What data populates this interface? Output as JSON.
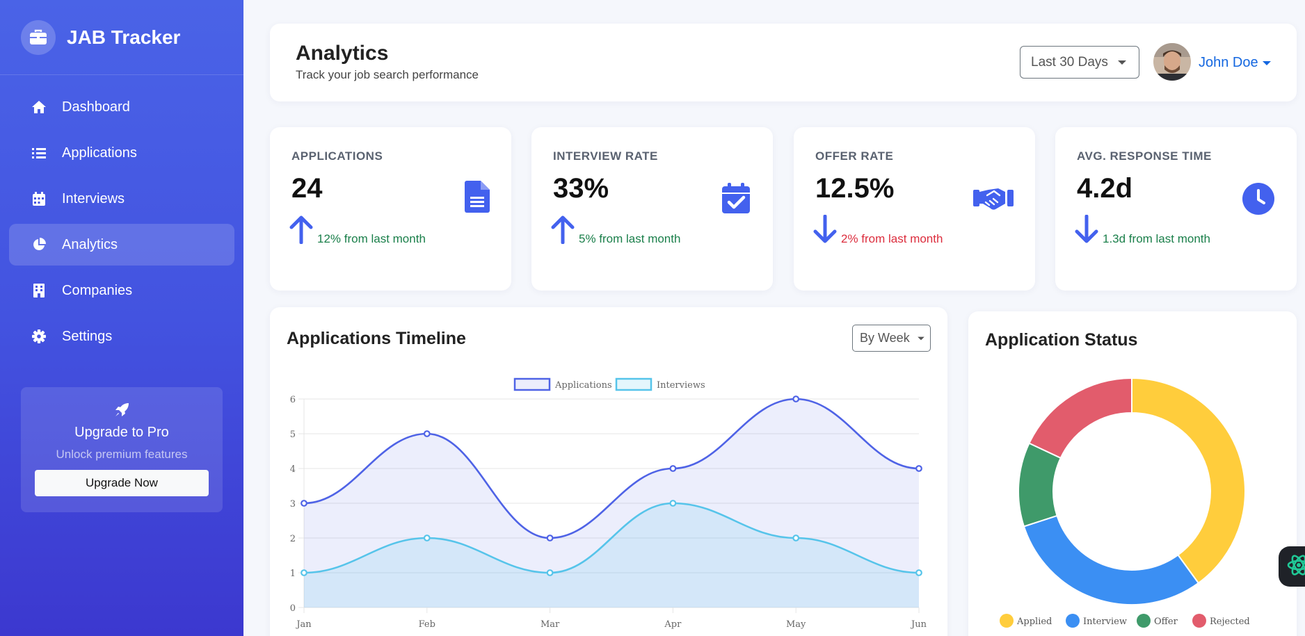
{
  "app": {
    "name": "JAB Tracker"
  },
  "sidebar": {
    "items": [
      {
        "label": "Dashboard",
        "icon": "home-icon",
        "active": false
      },
      {
        "label": "Applications",
        "icon": "list-icon",
        "active": false
      },
      {
        "label": "Interviews",
        "icon": "calendar-icon",
        "active": false
      },
      {
        "label": "Analytics",
        "icon": "pie-chart-icon",
        "active": true
      },
      {
        "label": "Companies",
        "icon": "building-icon",
        "active": false
      },
      {
        "label": "Settings",
        "icon": "gear-icon",
        "active": false
      }
    ],
    "promo": {
      "icon": "rocket-icon",
      "title": "Upgrade to Pro",
      "subtitle": "Unlock premium features",
      "button": "Upgrade Now"
    }
  },
  "header": {
    "title": "Analytics",
    "subtitle": "Track your job search performance",
    "range": "Last 30 Days",
    "user": "John Doe"
  },
  "stats": [
    {
      "label": "APPLICATIONS",
      "value": "24",
      "trend": "12% from last month",
      "direction": "up",
      "icon": "document-icon",
      "trend_color": "#1a7f4a"
    },
    {
      "label": "INTERVIEW RATE",
      "value": "33%",
      "trend": "5% from last month",
      "direction": "up",
      "icon": "calendar-check-icon",
      "trend_color": "#1a7f4a"
    },
    {
      "label": "OFFER RATE",
      "value": "12.5%",
      "trend": "2% from last month",
      "direction": "down",
      "icon": "handshake-icon",
      "trend_color": "#dc2d3d"
    },
    {
      "label": "AVG. RESPONSE TIME",
      "value": "4.2d",
      "trend": "1.3d from last month",
      "direction": "down",
      "icon": "clock-icon",
      "trend_color": "#1a7f4a"
    }
  ],
  "colors": {
    "accent": "#4361ee",
    "applications": "#4f63e6",
    "interviews": "#56c4ea"
  },
  "timeline": {
    "title": "Applications Timeline",
    "group_by": "By Week"
  },
  "status_chart": {
    "title": "Application Status"
  },
  "chart_data": [
    {
      "type": "area",
      "title": "Applications Timeline",
      "categories": [
        "Jan",
        "Feb",
        "Mar",
        "Apr",
        "May",
        "Jun"
      ],
      "series": [
        {
          "name": "Applications",
          "values": [
            3,
            5,
            2,
            4,
            6,
            4
          ],
          "color": "#4f63e6"
        },
        {
          "name": "Interviews",
          "values": [
            1,
            2,
            1,
            3,
            2,
            1
          ],
          "color": "#56c4ea"
        }
      ],
      "ylim": [
        0,
        6
      ],
      "yticks": [
        0,
        1,
        2,
        3,
        4,
        5,
        6
      ],
      "legend": "top",
      "grid": true
    },
    {
      "type": "pie",
      "title": "Application Status",
      "categories": [
        "Applied",
        "Interview",
        "Offer",
        "Rejected"
      ],
      "values": [
        40,
        30,
        12,
        18
      ],
      "colors": [
        "#ffcd3c",
        "#3b8ff3",
        "#3f9a6a",
        "#e25c6c"
      ],
      "legend": "bottom"
    }
  ]
}
